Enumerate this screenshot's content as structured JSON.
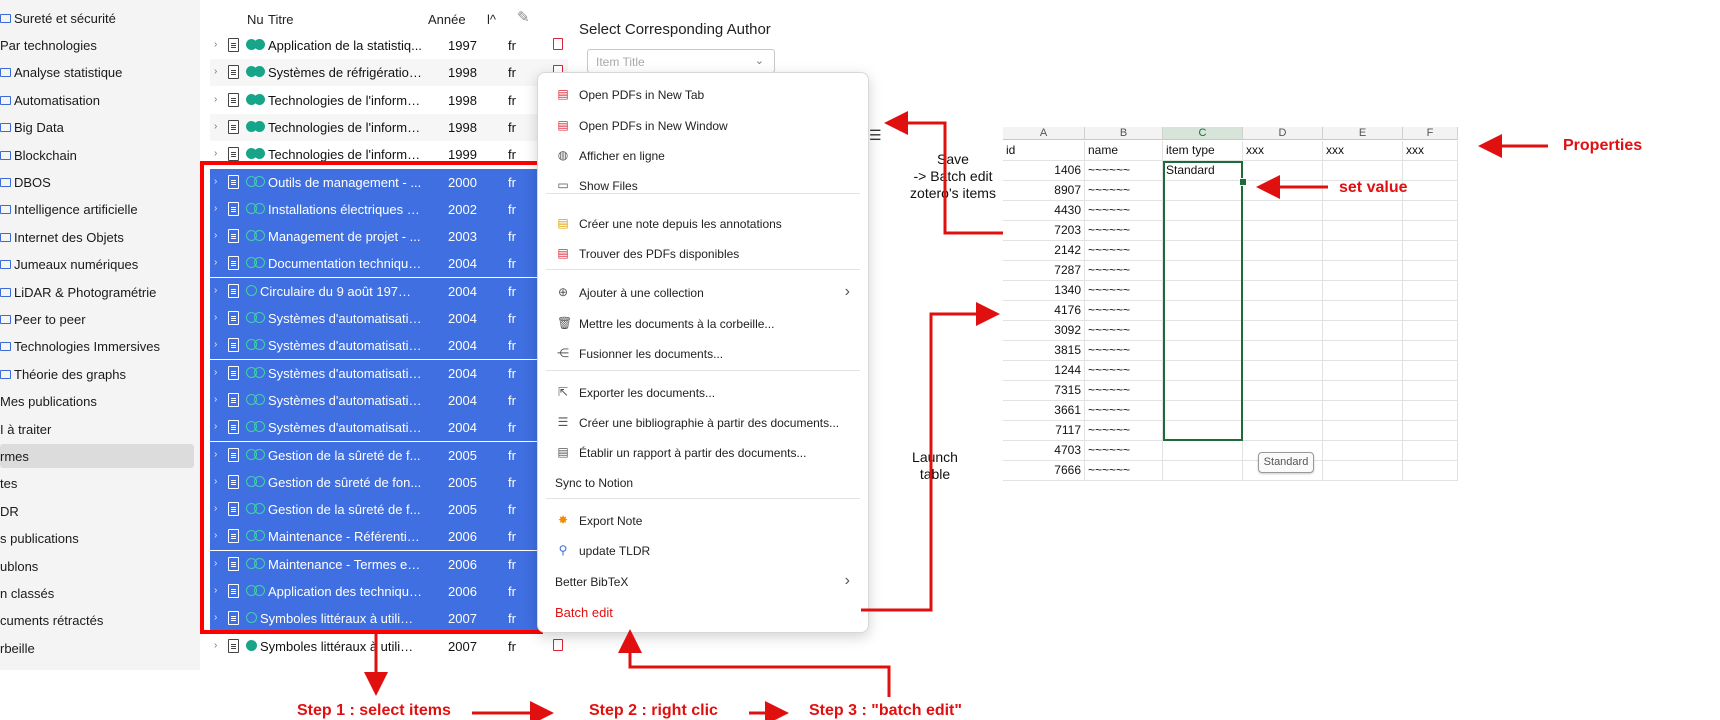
{
  "sidebar": {
    "items": [
      {
        "label": "Sureté et sécurité",
        "folder": true
      },
      {
        "label": "Par technologies",
        "folder": false
      },
      {
        "label": "Analyse statistique",
        "folder": true
      },
      {
        "label": "Automatisation",
        "folder": true
      },
      {
        "label": "Big Data",
        "folder": true
      },
      {
        "label": "Blockchain",
        "folder": true
      },
      {
        "label": "DBOS",
        "folder": true
      },
      {
        "label": "Intelligence artificielle",
        "folder": true
      },
      {
        "label": "Internet des Objets",
        "folder": true
      },
      {
        "label": "Jumeaux numériques",
        "folder": true
      },
      {
        "label": "LiDAR & Photogramétrie",
        "folder": true
      },
      {
        "label": "Peer to peer",
        "folder": true
      },
      {
        "label": "Technologies Immersives",
        "folder": true
      },
      {
        "label": "Théorie des graphs",
        "folder": true
      },
      {
        "label": "Mes publications",
        "folder": false
      },
      {
        "label": "I à traiter",
        "folder": false
      },
      {
        "label": "rmes",
        "folder": false
      },
      {
        "label": "tes",
        "folder": false
      },
      {
        "label": "DR",
        "folder": false
      },
      {
        "label": "s publications",
        "folder": false
      },
      {
        "label": "ublons",
        "folder": false
      },
      {
        "label": "n classés",
        "folder": false
      },
      {
        "label": "cuments rétractés",
        "folder": false
      },
      {
        "label": "rbeille",
        "folder": false
      }
    ],
    "selected_index": 16
  },
  "item_list": {
    "headers": {
      "num": "Nu",
      "title": "Titre",
      "year": "Année",
      "lang": "l^"
    },
    "rows": [
      {
        "title": "Application de la statistiq...",
        "year": "1997",
        "lang": "fr",
        "dots": "fill",
        "selected": false,
        "pdf": true
      },
      {
        "title": "Systèmes de réfrigération...",
        "year": "1998",
        "lang": "fr",
        "dots": "fill",
        "selected": false,
        "pdf": true
      },
      {
        "title": "Technologies de l'informa...",
        "year": "1998",
        "lang": "fr",
        "dots": "fill",
        "selected": false,
        "pdf": false
      },
      {
        "title": "Technologies de l'informa...",
        "year": "1998",
        "lang": "fr",
        "dots": "fill",
        "selected": false,
        "pdf": false
      },
      {
        "title": "Technologies de l'informa...",
        "year": "1999",
        "lang": "fr",
        "dots": "fill",
        "selected": false,
        "pdf": false
      },
      {
        "title": "Outils de management - ...",
        "year": "2000",
        "lang": "fr",
        "dots": "ring",
        "selected": true,
        "pdf": false
      },
      {
        "title": "Installations électriques à ...",
        "year": "2002",
        "lang": "fr",
        "dots": "ring",
        "selected": true,
        "pdf": false
      },
      {
        "title": "Management de projet - ...",
        "year": "2003",
        "lang": "fr",
        "dots": "ring",
        "selected": true,
        "pdf": false
      },
      {
        "title": "Documentation technique...",
        "year": "2004",
        "lang": "fr",
        "dots": "ring",
        "selected": true,
        "pdf": false
      },
      {
        "title": "Circulaire du 9 août 1978 ...",
        "year": "2004",
        "lang": "fr",
        "dots": "single",
        "selected": true,
        "pdf": false
      },
      {
        "title": "Systèmes d'automatisatio...",
        "year": "2004",
        "lang": "fr",
        "dots": "ring",
        "selected": true,
        "pdf": false
      },
      {
        "title": "Systèmes d'automatisatio...",
        "year": "2004",
        "lang": "fr",
        "dots": "ring",
        "selected": true,
        "pdf": false
      },
      {
        "title": "Systèmes d'automatisatio...",
        "year": "2004",
        "lang": "fr",
        "dots": "ring",
        "selected": true,
        "pdf": false
      },
      {
        "title": "Systèmes d'automatisatio...",
        "year": "2004",
        "lang": "fr",
        "dots": "ring",
        "selected": true,
        "pdf": false
      },
      {
        "title": "Systèmes d'automatisatio...",
        "year": "2004",
        "lang": "fr",
        "dots": "ring",
        "selected": true,
        "pdf": false
      },
      {
        "title": "Gestion de la sûreté de f...",
        "year": "2005",
        "lang": "fr",
        "dots": "ring",
        "selected": true,
        "pdf": false
      },
      {
        "title": "Gestion de sûreté de fon...",
        "year": "2005",
        "lang": "fr",
        "dots": "ring",
        "selected": true,
        "pdf": false
      },
      {
        "title": "Gestion de la sûreté de f...",
        "year": "2005",
        "lang": "fr",
        "dots": "ring",
        "selected": true,
        "pdf": false
      },
      {
        "title": "Maintenance - Référentiel...",
        "year": "2006",
        "lang": "fr",
        "dots": "ring",
        "selected": true,
        "pdf": false
      },
      {
        "title": "Maintenance - Termes et ...",
        "year": "2006",
        "lang": "fr",
        "dots": "ring",
        "selected": true,
        "pdf": false
      },
      {
        "title": "Application des technique...",
        "year": "2006",
        "lang": "fr",
        "dots": "ring",
        "selected": true,
        "pdf": false
      },
      {
        "title": "Symboles littéraux à utilise...",
        "year": "2007",
        "lang": "fr",
        "dots": "single",
        "selected": true,
        "pdf": false
      },
      {
        "title": "Symboles littéraux à utilise...",
        "year": "2007",
        "lang": "fr",
        "dots": "singlefill",
        "selected": false,
        "pdf": true
      }
    ]
  },
  "author_panel": {
    "title": "Select Corresponding Author",
    "placeholder": "Item Title"
  },
  "context_menu": {
    "items": [
      {
        "label": "Open PDFs in New Tab",
        "icon": "pdf-icon",
        "glyph": "▤",
        "color": "#d23"
      },
      {
        "label": "Open PDFs in New Window",
        "icon": "pdf-icon",
        "glyph": "▤",
        "color": "#d23"
      },
      {
        "label": "Afficher en ligne",
        "icon": "globe-icon",
        "glyph": "◍",
        "color": "#555"
      },
      {
        "label": "Show Files",
        "icon": "folder-icon",
        "glyph": "▭",
        "color": "#555"
      },
      {
        "label": "Créer une note depuis les annotations",
        "icon": "note-icon",
        "glyph": "▤",
        "color": "#e0a100"
      },
      {
        "label": "Trouver des PDFs disponibles",
        "icon": "pdf-search-icon",
        "glyph": "▤",
        "color": "#d23"
      },
      {
        "label": "Ajouter à une collection",
        "icon": "add-collection-icon",
        "glyph": "⊕",
        "color": "#555",
        "submenu": true
      },
      {
        "label": "Mettre les documents à la corbeille...",
        "icon": "trash-icon",
        "glyph": "🗑",
        "color": "#555"
      },
      {
        "label": "Fusionner les documents...",
        "icon": "merge-icon",
        "glyph": "⋲",
        "color": "#555"
      },
      {
        "label": "Exporter les documents...",
        "icon": "export-icon",
        "glyph": "⇱",
        "color": "#555"
      },
      {
        "label": "Créer une bibliographie à partir des documents...",
        "icon": "bibliography-icon",
        "glyph": "☰",
        "color": "#555"
      },
      {
        "label": "Établir un rapport à partir des documents...",
        "icon": "report-icon",
        "glyph": "▤",
        "color": "#555"
      },
      {
        "label": "Sync to Notion",
        "icon": "",
        "glyph": "",
        "color": "#555"
      },
      {
        "label": "Export Note",
        "icon": "export-note-icon",
        "glyph": "✸",
        "color": "#f08a00"
      },
      {
        "label": "update TLDR",
        "icon": "magnifier-icon",
        "glyph": "⚲",
        "color": "#3b6bd6"
      },
      {
        "label": "Better BibTeX",
        "icon": "",
        "glyph": "",
        "color": "#555",
        "submenu": true
      },
      {
        "label": "Batch edit",
        "icon": "",
        "glyph": "",
        "color": "#e01010"
      }
    ]
  },
  "spreadsheet": {
    "col_letters": [
      "A",
      "B",
      "C",
      "D",
      "E",
      "F"
    ],
    "headers": [
      "id",
      "name",
      "item type",
      "xxx",
      "xxx",
      "xxx"
    ],
    "rows": [
      {
        "id": "1406",
        "name": "~~~~~~",
        "type": "Standard"
      },
      {
        "id": "8907",
        "name": "~~~~~~",
        "type": ""
      },
      {
        "id": "4430",
        "name": "~~~~~~",
        "type": ""
      },
      {
        "id": "7203",
        "name": "~~~~~~",
        "type": ""
      },
      {
        "id": "2142",
        "name": "~~~~~~",
        "type": ""
      },
      {
        "id": "7287",
        "name": "~~~~~~",
        "type": ""
      },
      {
        "id": "1340",
        "name": "~~~~~~",
        "type": ""
      },
      {
        "id": "4176",
        "name": "~~~~~~",
        "type": ""
      },
      {
        "id": "3092",
        "name": "~~~~~~",
        "type": ""
      },
      {
        "id": "3815",
        "name": "~~~~~~",
        "type": ""
      },
      {
        "id": "1244",
        "name": "~~~~~~",
        "type": ""
      },
      {
        "id": "7315",
        "name": "~~~~~~",
        "type": ""
      },
      {
        "id": "3661",
        "name": "~~~~~~",
        "type": ""
      },
      {
        "id": "7117",
        "name": "~~~~~~",
        "type": ""
      },
      {
        "id": "4703",
        "name": "~~~~~~",
        "type": ""
      },
      {
        "id": "7666",
        "name": "~~~~~~",
        "type": ""
      }
    ],
    "tooltip": "Standard"
  },
  "annotations": {
    "save": [
      "Save",
      "-> Batch edit",
      "zotero's items"
    ],
    "launch": [
      "Launch",
      "table"
    ],
    "properties": "Properties",
    "set_value": "set value",
    "step1": "Step 1 : select items",
    "step2": "Step 2 : right clic",
    "step3": "Step 3 : \"batch edit\""
  },
  "colors": {
    "selection": "#3f6fe0",
    "annotation_red": "#e01010",
    "excel_green": "#1e6b3a",
    "dot_green": "#17a589"
  }
}
